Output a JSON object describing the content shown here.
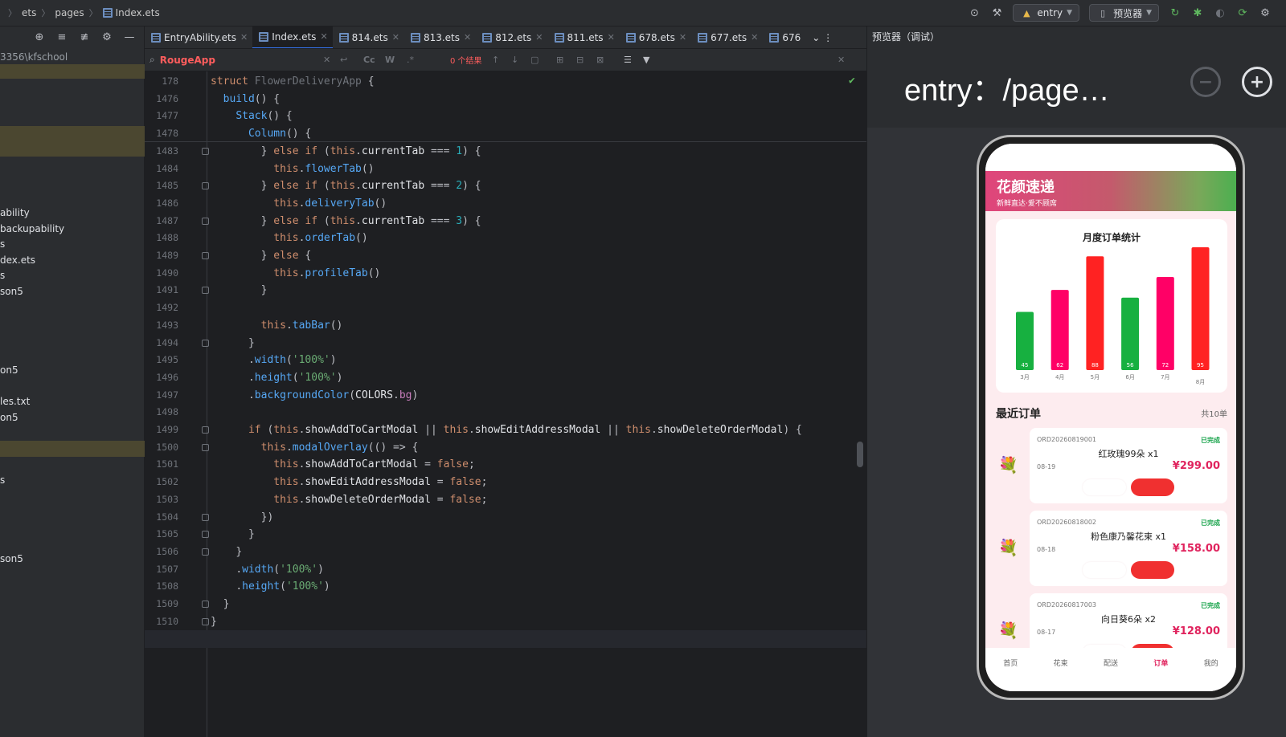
{
  "breadcrumb": [
    "ets",
    "pages",
    "Index.ets"
  ],
  "toolbar": {
    "module": "entry",
    "previewer": "预览器"
  },
  "project": {
    "path": "3356\\kfschool",
    "items": [
      {
        "label": "ability",
        "top": 265
      },
      {
        "label": "backupability",
        "top": 285
      },
      {
        "label": "s",
        "top": 304
      },
      {
        "label": "dex.ets",
        "top": 324
      },
      {
        "label": "s",
        "top": 343
      },
      {
        "label": "son5",
        "top": 363
      },
      {
        "label": "on5",
        "top": 461
      },
      {
        "label": "les.txt",
        "top": 500
      },
      {
        "label": "on5",
        "top": 520
      },
      {
        "label": "s",
        "top": 598
      },
      {
        "label": "son5",
        "top": 696
      }
    ]
  },
  "tabs": [
    {
      "label": "EntryAbility.ets",
      "active": false
    },
    {
      "label": "Index.ets",
      "active": true
    },
    {
      "label": "814.ets",
      "active": false
    },
    {
      "label": "813.ets",
      "active": false
    },
    {
      "label": "812.ets",
      "active": false
    },
    {
      "label": "811.ets",
      "active": false
    },
    {
      "label": "678.ets",
      "active": false
    },
    {
      "label": "677.ets",
      "active": false
    },
    {
      "label": "676",
      "active": false
    }
  ],
  "find": {
    "query": "RougeApp",
    "result": "0 个结果"
  },
  "code": {
    "sticky": [
      {
        "n": "178",
        "html": "<span class='kw'>struct</span> <span class='ty' style='color:#6f737a'>FlowerDeliveryApp</span> <span class='pl'>{</span>"
      },
      {
        "n": "1476",
        "html": "  <span class='fn'>build</span><span class='pl'>() {</span>"
      },
      {
        "n": "1477",
        "html": "    <span class='fn'>Stack</span><span class='pl'>() {</span>"
      },
      {
        "n": "1478",
        "html": "      <span class='fn'>Column</span><span class='pl'>() {</span>"
      }
    ],
    "lines": [
      {
        "n": "1483",
        "f": 1,
        "html": "        <span class='pl'>} </span><span class='kw'>else if</span> <span class='pl'>(</span><span class='th'>this</span><span class='pl'>.</span><span class='id'>currentTab</span> <span class='pl'>=== </span><span class='nm'>1</span><span class='pl'>) {</span>"
      },
      {
        "n": "1484",
        "f": 0,
        "html": "          <span class='th'>this</span><span class='pl'>.</span><span class='fn'>flowerTab</span><span class='pl'>()</span>"
      },
      {
        "n": "1485",
        "f": 1,
        "html": "        <span class='pl'>} </span><span class='kw'>else if</span> <span class='pl'>(</span><span class='th'>this</span><span class='pl'>.</span><span class='id'>currentTab</span> <span class='pl'>=== </span><span class='nm'>2</span><span class='pl'>) {</span>"
      },
      {
        "n": "1486",
        "f": 0,
        "html": "          <span class='th'>this</span><span class='pl'>.</span><span class='fn'>deliveryTab</span><span class='pl'>()</span>"
      },
      {
        "n": "1487",
        "f": 1,
        "html": "        <span class='pl'>} </span><span class='kw'>else if</span> <span class='pl'>(</span><span class='th'>this</span><span class='pl'>.</span><span class='id'>currentTab</span> <span class='pl'>=== </span><span class='nm'>3</span><span class='pl'>) {</span>"
      },
      {
        "n": "1488",
        "f": 0,
        "html": "          <span class='th'>this</span><span class='pl'>.</span><span class='fn'>orderTab</span><span class='pl'>()</span>"
      },
      {
        "n": "1489",
        "f": 1,
        "html": "        <span class='pl'>} </span><span class='kw'>else</span> <span class='pl'>{</span>"
      },
      {
        "n": "1490",
        "f": 0,
        "html": "          <span class='th'>this</span><span class='pl'>.</span><span class='fn'>profileTab</span><span class='pl'>()</span>"
      },
      {
        "n": "1491",
        "f": 1,
        "html": "        <span class='pl'>}</span>"
      },
      {
        "n": "1492",
        "f": 0,
        "html": ""
      },
      {
        "n": "1493",
        "f": 0,
        "html": "        <span class='th'>this</span><span class='pl'>.</span><span class='fn'>tabBar</span><span class='pl'>()</span>"
      },
      {
        "n": "1494",
        "f": 1,
        "html": "      <span class='pl'>}</span>"
      },
      {
        "n": "1495",
        "f": 0,
        "html": "      <span class='pl'>.</span><span class='fn'>width</span><span class='pl'>(</span><span class='st'>'100%'</span><span class='pl'>)</span>"
      },
      {
        "n": "1496",
        "f": 0,
        "html": "      <span class='pl'>.</span><span class='fn'>height</span><span class='pl'>(</span><span class='st'>'100%'</span><span class='pl'>)</span>"
      },
      {
        "n": "1497",
        "f": 0,
        "html": "      <span class='pl'>.</span><span class='fn'>backgroundColor</span><span class='pl'>(</span><span class='id'>COLORS</span><span class='pl'>.</span><span class='pr'>bg</span><span class='pl'>)</span>"
      },
      {
        "n": "1498",
        "f": 0,
        "html": ""
      },
      {
        "n": "1499",
        "f": 1,
        "html": "      <span class='kw'>if</span> <span class='pl'>(</span><span class='th'>this</span><span class='pl'>.</span><span class='id'>showAddToCartModal</span> <span class='pl'>|| </span><span class='th'>this</span><span class='pl'>.</span><span class='id'>showEditAddressModal</span> <span class='pl'>|| </span><span class='th'>this</span><span class='pl'>.</span><span class='id'>showDeleteOrderModal</span><span class='pl'>) {</span>"
      },
      {
        "n": "1500",
        "f": 1,
        "html": "        <span class='th'>this</span><span class='pl'>.</span><span class='fn'>modalOverlay</span><span class='pl'>(() => {</span>"
      },
      {
        "n": "1501",
        "f": 0,
        "html": "          <span class='th'>this</span><span class='pl'>.</span><span class='id'>showAddToCartModal</span> <span class='pl'>= </span><span class='kw'>false</span><span class='pl'>;</span>"
      },
      {
        "n": "1502",
        "f": 0,
        "html": "          <span class='th'>this</span><span class='pl'>.</span><span class='id'>showEditAddressModal</span> <span class='pl'>= </span><span class='kw'>false</span><span class='pl'>;</span>"
      },
      {
        "n": "1503",
        "f": 0,
        "html": "          <span class='th'>this</span><span class='pl'>.</span><span class='id'>showDeleteOrderModal</span> <span class='pl'>= </span><span class='kw'>false</span><span class='pl'>;</span>"
      },
      {
        "n": "1504",
        "f": 1,
        "html": "        <span class='pl'>})</span>"
      },
      {
        "n": "1505",
        "f": 1,
        "html": "      <span class='pl'>}</span>"
      },
      {
        "n": "1506",
        "f": 1,
        "html": "    <span class='pl'>}</span>"
      },
      {
        "n": "1507",
        "f": 0,
        "html": "    <span class='pl'>.</span><span class='fn'>width</span><span class='pl'>(</span><span class='st'>'100%'</span><span class='pl'>)</span>"
      },
      {
        "n": "1508",
        "f": 0,
        "html": "    <span class='pl'>.</span><span class='fn'>height</span><span class='pl'>(</span><span class='st'>'100%'</span><span class='pl'>)</span>"
      },
      {
        "n": "1509",
        "f": 1,
        "html": "  <span class='pl'>}</span>"
      },
      {
        "n": "1510",
        "f": 1,
        "html": "<span class='pl'>}</span>"
      },
      {
        "n": "1511",
        "f": 0,
        "html": ""
      }
    ]
  },
  "previewer": {
    "panel_title": "预览器（调试）",
    "route": "entry：/page…"
  },
  "app": {
    "title": "花颜速递",
    "subtitle": "新鲜直达·爱不顾席",
    "chart_title": "月度订单统计",
    "orders_title": "最近订单",
    "orders_count": "共10单",
    "orders": [
      {
        "id": "ORD20260819001",
        "status": "已完成",
        "name": "红玫瑰99朵 x1",
        "date": "08-19",
        "price": "¥299.00"
      },
      {
        "id": "ORD20260818002",
        "status": "已完成",
        "name": "粉色康乃馨花束 x1",
        "date": "08-18",
        "price": "¥158.00"
      },
      {
        "id": "ORD20260817003",
        "status": "已完成",
        "name": "向日葵6朵 x2",
        "date": "08-17",
        "price": "¥128.00"
      }
    ],
    "tabs": [
      "首页",
      "花束",
      "配送",
      "订单",
      "我的"
    ],
    "active_tab": 3
  },
  "chart_data": {
    "type": "bar",
    "title": "月度订单统计",
    "categories": [
      "3月",
      "4月",
      "5月",
      "6月",
      "7月",
      "8月"
    ],
    "values": [
      45,
      62,
      88,
      56,
      72,
      95
    ],
    "colors": [
      "#17b040",
      "#ff0066",
      "#ff2222",
      "#17b040",
      "#ff0066",
      "#ff2222"
    ],
    "ylim": [
      0,
      95
    ],
    "grid": false,
    "legend": "none"
  }
}
